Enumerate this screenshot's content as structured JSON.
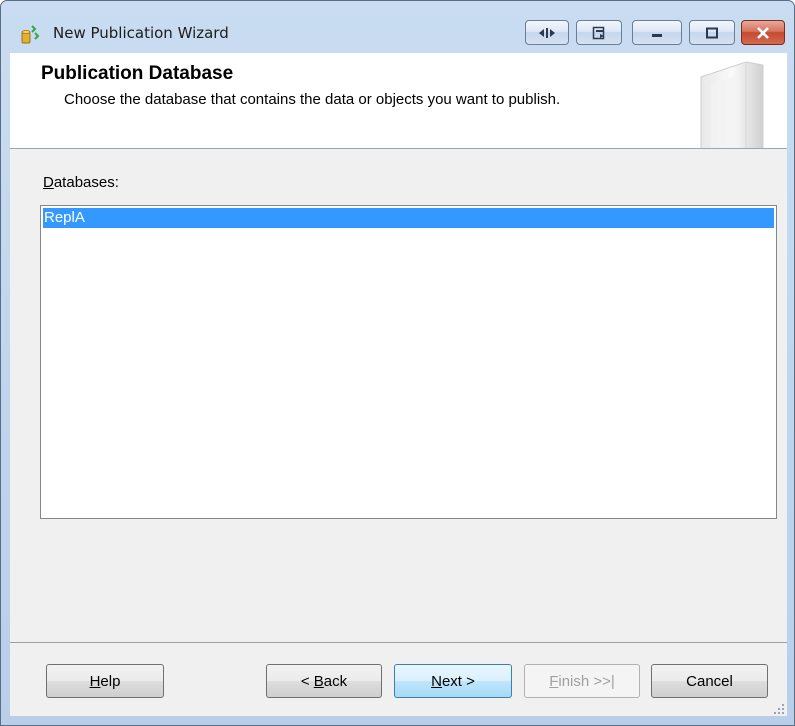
{
  "window": {
    "title": "New Publication Wizard"
  },
  "header": {
    "title": "Publication Database",
    "subtitle": "Choose the database that contains the data or objects you want to publish."
  },
  "databases": {
    "label_mnemonic": "D",
    "label_rest": "atabases:",
    "items": [
      "ReplA"
    ],
    "selected": "ReplA"
  },
  "buttons": {
    "help": {
      "mn": "H",
      "rest": "elp"
    },
    "back": {
      "pre": "< ",
      "mn": "B",
      "rest": "ack"
    },
    "next": {
      "mn": "N",
      "rest": "ext >"
    },
    "finish": {
      "mn": "F",
      "rest": "inish >>|"
    },
    "cancel": {
      "label": "Cancel"
    }
  },
  "colors": {
    "selection": "#3399ff",
    "close_button": "#c44a30"
  }
}
